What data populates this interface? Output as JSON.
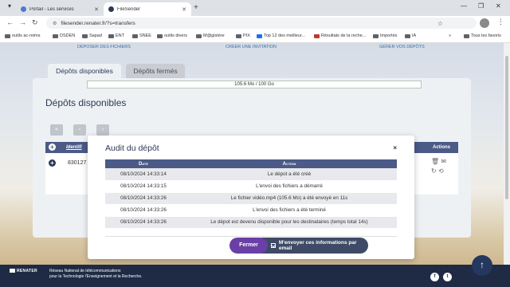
{
  "browser": {
    "tabs": [
      {
        "title": "Portail - Les services"
      },
      {
        "title": "FileSender"
      }
    ],
    "new_tab": "+",
    "url": "filesender.renater.fr/?s=transfers",
    "bookmarks": [
      "outils ac-reims",
      "DSDEN",
      "Sapad",
      "ENT",
      "SNEE",
      "outils divers",
      "M@gistère",
      "PIX",
      "Top 12 des meilleur...",
      "Résultats de la reche...",
      "Importés",
      "IA"
    ],
    "bookmarks_more": "»",
    "all_favorites": "Tous les favoris"
  },
  "nav": {
    "deposit": "DÉPOSER DES FICHIERS",
    "invite": "CRÉER UNE INVITATION",
    "manage": "GÉRER VOS DÉPÔTS"
  },
  "page_tabs": {
    "available": "Dépôts disponibles",
    "closed": "Dépôts fermés"
  },
  "quota": "105.6 Mo / 100 Go",
  "panel_title": "Dépôts disponibles",
  "pager": [
    "«",
    "‹",
    "›"
  ],
  "table": {
    "col_id": "Identifi",
    "col_actions": "Actions",
    "row_id": "830127"
  },
  "audit": {
    "title": "Audit du dépôt",
    "close": "×",
    "headers": {
      "date": "Date",
      "action": "Action"
    },
    "rows": [
      {
        "date": "08/10/2024 14:33:14",
        "action": "Le dépot a été créé"
      },
      {
        "date": "08/10/2024 14:33:15",
        "action": "L'envoi des fichiers a démarré"
      },
      {
        "date": "08/10/2024 14:33:26",
        "action": "Le fichier vidéo.mp4 (105.6 Mo) a été envoyé en 11s"
      },
      {
        "date": "08/10/2024 14:33:26",
        "action": "L'envoi des fichiers a été terminé"
      },
      {
        "date": "08/10/2024 14:33:26",
        "action": "Le dépot est devenu disponible pour les destinataires (temps total 14s)"
      }
    ],
    "close_button": "Fermer",
    "send_email": "M'envoyer ces informations par email"
  },
  "footer": {
    "logo": "RENATER",
    "line1": "Réseau National de télécommunications",
    "line2": "pour la Technologie l'Enseignement et la Recherche."
  },
  "colors": {
    "header_blue": "#4b5a86",
    "fermer_purple": "#6a3fa6",
    "footer_navy": "#1f2a44"
  }
}
